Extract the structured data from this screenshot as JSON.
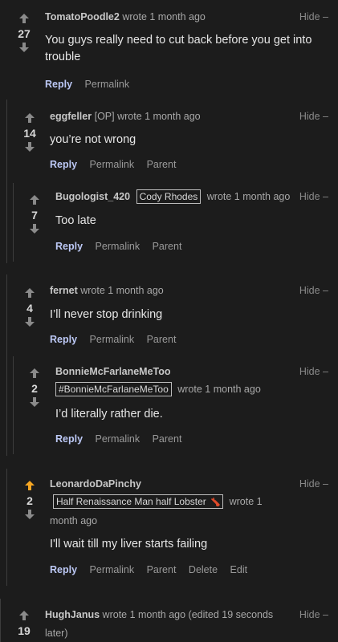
{
  "comments": [
    {
      "author": "TomatoPoodle2",
      "meta": "wrote 1 month ago",
      "score": "27",
      "hide": "Hide –",
      "body": "You guys really need to cut back before you get into trouble",
      "actions": [
        "Reply",
        "Permalink"
      ]
    },
    {
      "author": "eggfeller",
      "op": "[OP]",
      "meta": "wrote 1 month ago",
      "score": "14",
      "hide": "Hide –",
      "body": "you’re not wrong",
      "actions": [
        "Reply",
        "Permalink",
        "Parent"
      ]
    },
    {
      "author": "Bugologist_420",
      "flair": "Cody Rhodes",
      "meta": "wrote 1 month ago",
      "score": "7",
      "hide": "Hide –",
      "body": "Too late",
      "actions": [
        "Reply",
        "Permalink",
        "Parent"
      ]
    },
    {
      "author": "fernet",
      "meta": "wrote 1 month ago",
      "score": "4",
      "hide": "Hide –",
      "body": "I’ll never stop drinking",
      "actions": [
        "Reply",
        "Permalink",
        "Parent"
      ]
    },
    {
      "author": "BonnieMcFarlaneMeToo",
      "flair": "#BonnieMcFarlaneMeToo",
      "meta": "wrote 1 month ago",
      "score": "2",
      "hide": "Hide –",
      "body": "I’d literally rather die.",
      "actions": [
        "Reply",
        "Permalink",
        "Parent"
      ]
    },
    {
      "author": "LeonardoDaPinchy",
      "flair": "Half Renaissance Man half Lobster",
      "meta1": "wrote 1",
      "meta2": "month ago",
      "score": "2",
      "hide": "Hide –",
      "body": "I'll wait till my liver starts failing",
      "actions": [
        "Reply",
        "Permalink",
        "Parent",
        "Delete",
        "Edit"
      ]
    },
    {
      "author": "HughJanus",
      "meta1": "wrote 1 month ago (edited 19 seconds",
      "meta2": "later)",
      "score": "19",
      "hide": "Hide –"
    }
  ],
  "colors": {
    "upvoted": "#f5a623",
    "arrow": "#8a8a8a",
    "reply": "#bcc8f5"
  }
}
